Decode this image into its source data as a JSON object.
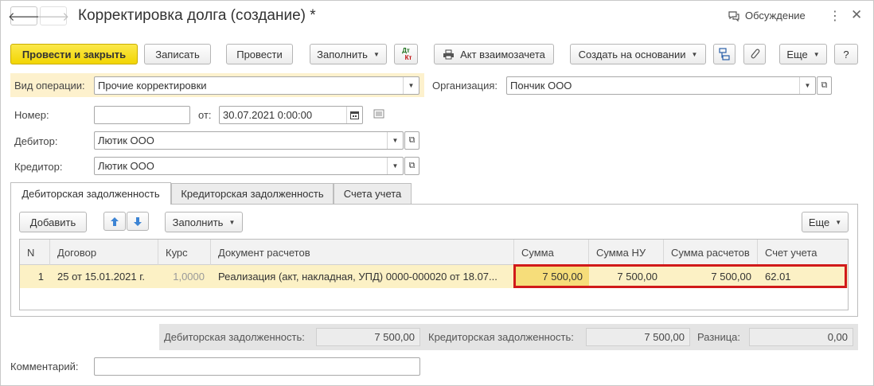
{
  "window": {
    "title": "Корректировка долга (создание) *",
    "discuss_label": "Обсуждение"
  },
  "toolbar": {
    "post_close": "Провести и закрыть",
    "save": "Записать",
    "post": "Провести",
    "fill": "Заполнить",
    "dtkt_top": "Дт",
    "dtkt_bottom": "Кт",
    "act": "Акт взаимозачета",
    "create_based": "Создать на основании",
    "more": "Еще",
    "help": "?"
  },
  "form": {
    "op_type_label": "Вид операции:",
    "op_type_value": "Прочие корректировки",
    "org_label": "Организация:",
    "org_value": "Пончик ООО",
    "number_label": "Номер:",
    "number_value": "",
    "date_label": "от:",
    "date_value": "30.07.2021  0:00:00",
    "debtor_label": "Дебитор:",
    "debtor_value": "Лютик ООО",
    "creditor_label": "Кредитор:",
    "creditor_value": "Лютик ООО",
    "comment_label": "Комментарий:",
    "comment_value": ""
  },
  "tabs": [
    {
      "label": "Дебиторская задолженность",
      "active": true
    },
    {
      "label": "Кредиторская задолженность",
      "active": false
    },
    {
      "label": "Счета учета",
      "active": false
    }
  ],
  "table_toolbar": {
    "add": "Добавить",
    "fill": "Заполнить",
    "more": "Еще"
  },
  "table": {
    "columns": [
      "N",
      "Договор",
      "Курс",
      "Документ расчетов",
      "Сумма",
      "Сумма НУ",
      "Сумма расчетов",
      "Счет учета"
    ],
    "rows": [
      {
        "n": "1",
        "contract": "25 от 15.01.2021 г.",
        "rate": "1,0000",
        "doc": "Реализация (акт, накладная, УПД) 0000-000020 от 18.07...",
        "sum": "7 500,00",
        "sum_nu": "7 500,00",
        "sum_calc": "7 500,00",
        "account": "62.01"
      }
    ]
  },
  "totals": {
    "debit_label": "Дебиторская задолженность:",
    "debit_value": "7 500,00",
    "credit_label": "Кредиторская задолженность:",
    "credit_value": "7 500,00",
    "diff_label": "Разница:",
    "diff_value": "0,00"
  },
  "colors": {
    "primary_button": "#f2d503",
    "highlight_row": "#fcf1c5",
    "selection_border": "#d11a1a"
  }
}
